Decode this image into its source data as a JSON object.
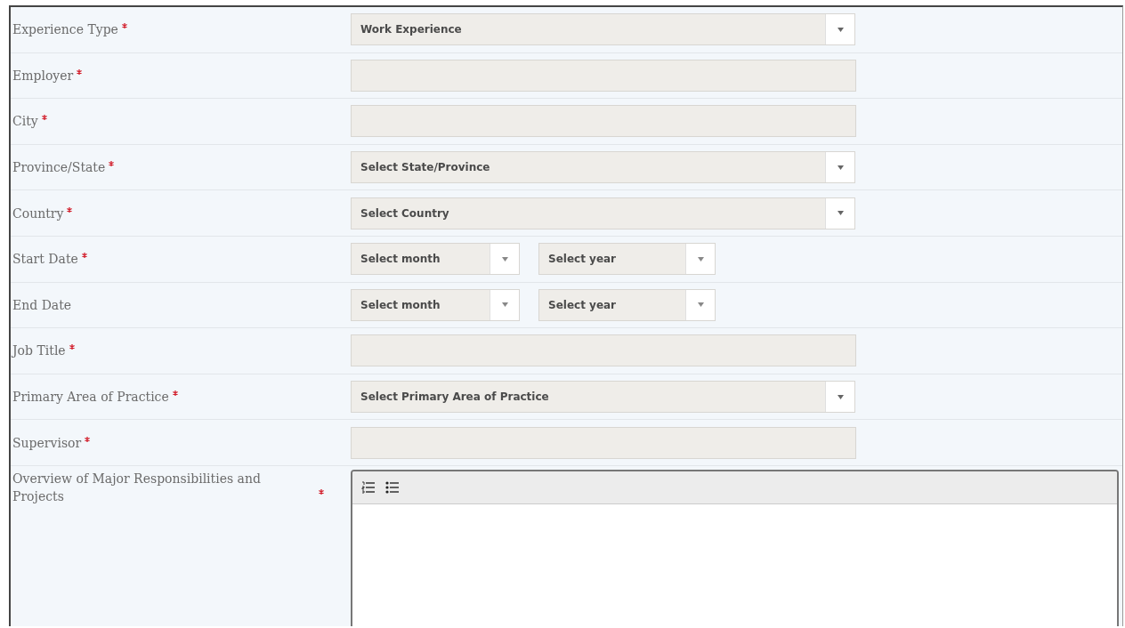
{
  "rows": [
    {
      "label": "Experience Type",
      "required": true,
      "kind": "select",
      "value": "Work Experience"
    },
    {
      "label": "Employer",
      "required": true,
      "kind": "text"
    },
    {
      "label": "City",
      "required": true,
      "kind": "text"
    },
    {
      "label": "Province/State",
      "required": true,
      "kind": "select",
      "value": "Select State/Province"
    },
    {
      "label": "Country",
      "required": true,
      "kind": "select",
      "value": "Select Country"
    },
    {
      "label": "Start Date",
      "required": true,
      "kind": "date",
      "month": "Select month",
      "year": "Select year"
    },
    {
      "label": "End Date",
      "required": false,
      "kind": "date",
      "month": "Select month",
      "year": "Select year"
    },
    {
      "label": "Job Title",
      "required": true,
      "kind": "text"
    },
    {
      "label": "Primary Area of Practice",
      "required": true,
      "kind": "select",
      "value": "Select Primary Area of Practice"
    },
    {
      "label": "Supervisor",
      "required": true,
      "kind": "text"
    },
    {
      "label": "Overview of Major Responsibilities and Projects",
      "required": true,
      "kind": "richtext"
    }
  ]
}
